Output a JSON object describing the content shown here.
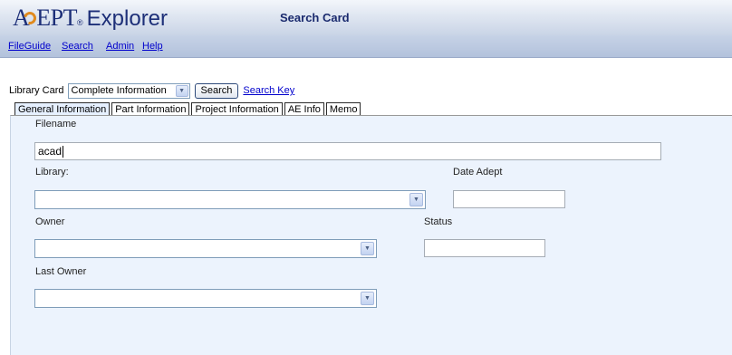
{
  "header": {
    "logo_a": "A",
    "logo_dept": "EPT",
    "logo_tm": "®",
    "logo_explorer": "Explorer",
    "page_title": "Search Card"
  },
  "menu": {
    "items": [
      {
        "label": "FileGuide"
      },
      {
        "label": "Search"
      },
      {
        "label": "Admin"
      },
      {
        "label": "Help"
      }
    ]
  },
  "search": {
    "label": "Library Card",
    "card_selected": "Complete Information",
    "button_label": "Search",
    "key_link": "Search Key"
  },
  "tabs": [
    {
      "label": "General Information",
      "active": true
    },
    {
      "label": "Part Information",
      "active": false
    },
    {
      "label": "Project Information",
      "active": false
    },
    {
      "label": "AE Info",
      "active": false
    },
    {
      "label": "Memo",
      "active": false
    }
  ],
  "form": {
    "filename_label": "Filename",
    "filename_value": "acad",
    "library_label": "Library:",
    "library_value": "",
    "date_adept_label": "Date Adept",
    "date_adept_value": "",
    "owner_label": "Owner",
    "owner_value": "",
    "status_label": "Status",
    "status_value": "",
    "last_owner_label": "Last Owner",
    "last_owner_value": ""
  },
  "colors": {
    "header_text": "#1a2a6e",
    "link": "#0000cc",
    "panel_bg": "#ecf3fd",
    "menubar_bg": "#b3c2dc",
    "logo_accent": "#e08a1e"
  }
}
